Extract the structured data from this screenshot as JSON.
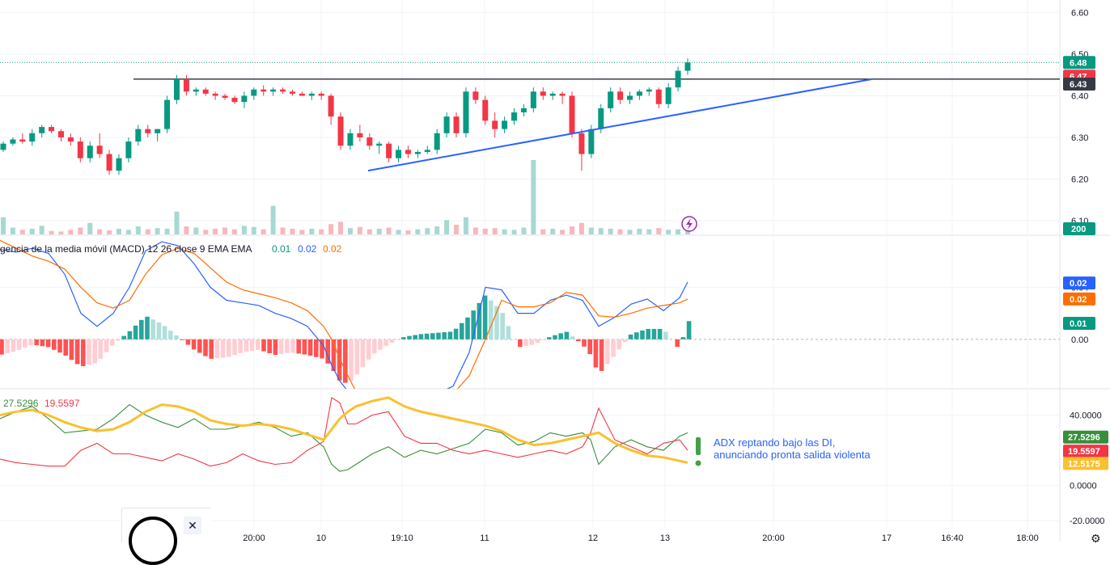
{
  "chart_data": [
    {
      "type": "candlestick",
      "panel": "price",
      "y_ticks": [
        "6.60",
        "6.50",
        "6.40",
        "6.30",
        "6.20",
        "6.10"
      ],
      "y_tick_values": [
        6.6,
        6.5,
        6.4,
        6.3,
        6.2,
        6.1
      ],
      "ylim": [
        6.065,
        6.63
      ],
      "price_tags": [
        {
          "label": "6.48",
          "value": 6.48,
          "color": "#089981"
        },
        {
          "label": "6.47",
          "value": 6.447,
          "color": "#f23645"
        },
        {
          "label": "6.43",
          "value": 6.428,
          "color": "#363a45"
        }
      ],
      "volume_tag": {
        "label": "200",
        "color": "#089981"
      },
      "last_price_line": 6.48,
      "horizontal_line": 6.44,
      "trendline": {
        "from": [
          455,
          6.22
        ],
        "to": [
          1078,
          6.44
        ],
        "color": "#2962ff"
      },
      "candles": [
        [
          6.27,
          6.29,
          6.265,
          6.285
        ],
        [
          6.285,
          6.3,
          6.28,
          6.295
        ],
        [
          6.295,
          6.31,
          6.285,
          6.29
        ],
        [
          6.29,
          6.32,
          6.28,
          6.31
        ],
        [
          6.31,
          6.33,
          6.3,
          6.325
        ],
        [
          6.325,
          6.33,
          6.31,
          6.315
        ],
        [
          6.315,
          6.32,
          6.29,
          6.3
        ],
        [
          6.3,
          6.31,
          6.28,
          6.29
        ],
        [
          6.29,
          6.3,
          6.24,
          6.25
        ],
        [
          6.25,
          6.29,
          6.24,
          6.28
        ],
        [
          6.28,
          6.31,
          6.25,
          6.26
        ],
        [
          6.26,
          6.27,
          6.21,
          6.22
        ],
        [
          6.22,
          6.26,
          6.21,
          6.25
        ],
        [
          6.25,
          6.3,
          6.24,
          6.29
        ],
        [
          6.29,
          6.33,
          6.28,
          6.32
        ],
        [
          6.32,
          6.33,
          6.3,
          6.31
        ],
        [
          6.31,
          6.32,
          6.29,
          6.32
        ],
        [
          6.32,
          6.4,
          6.31,
          6.39
        ],
        [
          6.39,
          6.45,
          6.38,
          6.44
        ],
        [
          6.44,
          6.45,
          6.4,
          6.41
        ],
        [
          6.41,
          6.42,
          6.4,
          6.415
        ],
        [
          6.415,
          6.42,
          6.4,
          6.405
        ],
        [
          6.405,
          6.41,
          6.39,
          6.4
        ],
        [
          6.4,
          6.405,
          6.39,
          6.395
        ],
        [
          6.395,
          6.4,
          6.38,
          6.385
        ],
        [
          6.385,
          6.41,
          6.37,
          6.4
        ],
        [
          6.4,
          6.42,
          6.39,
          6.415
        ],
        [
          6.415,
          6.425,
          6.4,
          6.41
        ],
        [
          6.41,
          6.42,
          6.4,
          6.415
        ],
        [
          6.415,
          6.42,
          6.405,
          6.41
        ],
        [
          6.41,
          6.415,
          6.4,
          6.405
        ],
        [
          6.405,
          6.41,
          6.4,
          6.4
        ],
        [
          6.4,
          6.41,
          6.39,
          6.405
        ],
        [
          6.405,
          6.41,
          6.39,
          6.4
        ],
        [
          6.4,
          6.405,
          6.33,
          6.35
        ],
        [
          6.35,
          6.36,
          6.27,
          6.28
        ],
        [
          6.28,
          6.32,
          6.27,
          6.31
        ],
        [
          6.31,
          6.33,
          6.29,
          6.3
        ],
        [
          6.3,
          6.31,
          6.27,
          6.28
        ],
        [
          6.28,
          6.29,
          6.26,
          6.285
        ],
        [
          6.285,
          6.29,
          6.24,
          6.25
        ],
        [
          6.25,
          6.28,
          6.24,
          6.27
        ],
        [
          6.27,
          6.28,
          6.25,
          6.26
        ],
        [
          6.26,
          6.27,
          6.25,
          6.265
        ],
        [
          6.265,
          6.28,
          6.26,
          6.27
        ],
        [
          6.27,
          6.32,
          6.26,
          6.31
        ],
        [
          6.31,
          6.36,
          6.3,
          6.35
        ],
        [
          6.35,
          6.36,
          6.3,
          6.31
        ],
        [
          6.31,
          6.42,
          6.3,
          6.41
        ],
        [
          6.41,
          6.42,
          6.38,
          6.39
        ],
        [
          6.39,
          6.4,
          6.33,
          6.34
        ],
        [
          6.34,
          6.36,
          6.3,
          6.32
        ],
        [
          6.32,
          6.35,
          6.31,
          6.34
        ],
        [
          6.34,
          6.37,
          6.33,
          6.36
        ],
        [
          6.36,
          6.38,
          6.35,
          6.37
        ],
        [
          6.37,
          6.42,
          6.36,
          6.41
        ],
        [
          6.41,
          6.42,
          6.39,
          6.4
        ],
        [
          6.4,
          6.41,
          6.39,
          6.405
        ],
        [
          6.405,
          6.41,
          6.38,
          6.4
        ],
        [
          6.4,
          6.41,
          6.3,
          6.31
        ],
        [
          6.31,
          6.32,
          6.22,
          6.26
        ],
        [
          6.26,
          6.33,
          6.25,
          6.32
        ],
        [
          6.32,
          6.38,
          6.31,
          6.37
        ],
        [
          6.37,
          6.42,
          6.36,
          6.41
        ],
        [
          6.41,
          6.42,
          6.38,
          6.39
        ],
        [
          6.39,
          6.41,
          6.38,
          6.4
        ],
        [
          6.4,
          6.415,
          6.39,
          6.41
        ],
        [
          6.41,
          6.42,
          6.4,
          6.415
        ],
        [
          6.415,
          6.42,
          6.37,
          6.38
        ],
        [
          6.38,
          6.43,
          6.37,
          6.42
        ],
        [
          6.42,
          6.47,
          6.41,
          6.46
        ],
        [
          6.46,
          6.49,
          6.45,
          6.48
        ]
      ],
      "volume": [
        30,
        12,
        8,
        10,
        15,
        6,
        5,
        8,
        12,
        20,
        9,
        7,
        10,
        8,
        14,
        9,
        11,
        10,
        40,
        14,
        12,
        8,
        10,
        12,
        9,
        15,
        13,
        9,
        50,
        12,
        10,
        8,
        10,
        9,
        18,
        22,
        11,
        13,
        9,
        10,
        12,
        8,
        7,
        9,
        11,
        14,
        25,
        17,
        30,
        12,
        10,
        11,
        9,
        8,
        12,
        130,
        9,
        10,
        8,
        14,
        20,
        12,
        11,
        10,
        9,
        8,
        10,
        9,
        11,
        8,
        9,
        10
      ]
    },
    {
      "type": "line",
      "panel": "macd",
      "legend": {
        "label": "gencia de la media móvil (MACD)  12 26 close 9 EMA EMA",
        "values": [
          "0.01",
          "0.02",
          "0.02"
        ]
      },
      "y_ticks": [
        "0.04",
        "0.00"
      ],
      "y_tick_values": [
        0.04,
        0.0
      ],
      "ylim": [
        -0.038,
        0.08
      ],
      "tags": [
        {
          "label": "0.02",
          "value": 0.0433,
          "color": "#2962ff"
        },
        {
          "label": "0.02",
          "value": 0.031,
          "color": "#ff6d00"
        },
        {
          "label": "0.01",
          "value": 0.0123,
          "color": "#089981"
        }
      ],
      "x": [
        0,
        20,
        40,
        60,
        80,
        100,
        120,
        140,
        160,
        180,
        200,
        220,
        240,
        260,
        280,
        300,
        320,
        340,
        360,
        380,
        400,
        410,
        420,
        430,
        440,
        460,
        480,
        500,
        520,
        540,
        560,
        580,
        600,
        620,
        640,
        660,
        680,
        700,
        720,
        730,
        740,
        760,
        780,
        800,
        820,
        840,
        850
      ],
      "macd_line": [
        0.069,
        0.067,
        0.07,
        0.066,
        0.05,
        0.02,
        0.01,
        0.02,
        0.04,
        0.068,
        0.075,
        0.072,
        0.058,
        0.04,
        0.03,
        0.028,
        0.026,
        0.02,
        0.016,
        0.01,
        -0.005,
        -0.02,
        -0.032,
        -0.04,
        -0.045,
        -0.05,
        -0.052,
        -0.05,
        -0.046,
        -0.042,
        -0.036,
        -0.01,
        0.04,
        0.038,
        0.02,
        0.02,
        0.03,
        0.034,
        0.03,
        0.02,
        0.01,
        0.017,
        0.027,
        0.031,
        0.022,
        0.032,
        0.044
      ],
      "signal_line": [
        0.076,
        0.07,
        0.064,
        0.06,
        0.054,
        0.04,
        0.028,
        0.024,
        0.03,
        0.05,
        0.065,
        0.07,
        0.066,
        0.055,
        0.044,
        0.038,
        0.035,
        0.032,
        0.028,
        0.022,
        0.01,
        0.0,
        -0.015,
        -0.028,
        -0.04,
        -0.048,
        -0.05,
        -0.051,
        -0.05,
        -0.047,
        -0.042,
        -0.028,
        0.0,
        0.03,
        0.025,
        0.025,
        0.028,
        0.036,
        0.034,
        0.026,
        0.018,
        0.017,
        0.02,
        0.024,
        0.026,
        0.028,
        0.031
      ],
      "histogram": [
        -0.012,
        -0.009,
        -0.004,
        -0.006,
        -0.012,
        -0.021,
        -0.018,
        -0.004,
        0.006,
        0.018,
        0.012,
        0.002,
        -0.008,
        -0.015,
        -0.014,
        -0.01,
        -0.008,
        -0.012,
        -0.01,
        -0.012,
        -0.015,
        -0.022,
        -0.032,
        -0.034,
        -0.028,
        -0.012,
        -0.004,
        0.002,
        0.004,
        0.005,
        0.006,
        0.018,
        0.034,
        0.022,
        -0.006,
        -0.004,
        0.002,
        0.006,
        -0.004,
        -0.012,
        -0.027,
        -0.012,
        0.004,
        0.008,
        0.008,
        -0.008,
        0.014
      ]
    },
    {
      "type": "line",
      "panel": "adx",
      "legend": {
        "values": [
          "27.5296",
          "19.5597"
        ]
      },
      "y_ticks": [
        "40.0000",
        "0.0000",
        "-20.0000"
      ],
      "y_tick_values": [
        40,
        0,
        -20
      ],
      "ylim": [
        -25,
        55
      ],
      "tags": [
        {
          "label": "27.5296",
          "value": 27.53,
          "color": "#388e3c"
        },
        {
          "label": "19.5597",
          "value": 19.56,
          "color": "#f23645"
        },
        {
          "label": "12.5175",
          "value": 12.52,
          "color": "#fbc02d"
        }
      ],
      "x": [
        0,
        20,
        40,
        60,
        80,
        100,
        120,
        140,
        160,
        180,
        200,
        220,
        240,
        260,
        280,
        300,
        320,
        340,
        360,
        380,
        400,
        410,
        420,
        430,
        440,
        460,
        480,
        500,
        520,
        540,
        560,
        580,
        600,
        620,
        640,
        660,
        680,
        700,
        720,
        730,
        740,
        760,
        780,
        800,
        820,
        840,
        850
      ],
      "di_plus": [
        38,
        42,
        45,
        38,
        30,
        31,
        32,
        38,
        46,
        40,
        36,
        33,
        38,
        32,
        32,
        34,
        36,
        33,
        28,
        30,
        22,
        12,
        8,
        9,
        12,
        18,
        22,
        16,
        20,
        18,
        21,
        24,
        32,
        30,
        23,
        25,
        30,
        28,
        30,
        26,
        12,
        22,
        26,
        22,
        20,
        28,
        30
      ],
      "di_minus": [
        15,
        13,
        12,
        11,
        11,
        20,
        24,
        18,
        18,
        16,
        14,
        18,
        15,
        11,
        13,
        18,
        14,
        12,
        13,
        20,
        25,
        50,
        47,
        35,
        35,
        40,
        42,
        28,
        24,
        24,
        20,
        18,
        20,
        18,
        16,
        18,
        20,
        18,
        22,
        30,
        44,
        26,
        22,
        18,
        24,
        26,
        20
      ],
      "adx": [
        40,
        42,
        43,
        40,
        36,
        33,
        31,
        32,
        36,
        42,
        46,
        45,
        42,
        37,
        35,
        34,
        35,
        34,
        32,
        29,
        26,
        32,
        38,
        42,
        45,
        48,
        50,
        45,
        42,
        40,
        38,
        36,
        34,
        31,
        26,
        23,
        24,
        26,
        28,
        29,
        30,
        24,
        20,
        17,
        16,
        14,
        13
      ],
      "annotation": "ADX reptando bajo las DI,\nanunciando pronta salida violenta"
    }
  ],
  "time_axis": {
    "labels": [
      {
        "text": "20:00",
        "x": 314
      },
      {
        "text": "10",
        "x": 397
      },
      {
        "text": "19:10",
        "x": 497
      },
      {
        "text": "11",
        "x": 599
      },
      {
        "text": "12",
        "x": 733
      },
      {
        "text": "13",
        "x": 822
      },
      {
        "text": "20:00",
        "x": 956
      },
      {
        "text": "17",
        "x": 1096
      },
      {
        "text": "16:40",
        "x": 1177
      },
      {
        "text": "18:00",
        "x": 1270
      }
    ]
  },
  "annotation_lines": [
    "ADX reptando bajo las DI,",
    "anunciando pronta salida violenta"
  ],
  "colors": {
    "up": "#089981",
    "down": "#f23645",
    "macd": "#2962ff",
    "signal": "#ff6d00",
    "hist_up_strong": "#26a69a",
    "hist_up_weak": "#b2dfdb",
    "hist_down_strong": "#ff5252",
    "hist_down_weak": "#ffcdd2",
    "di_plus": "#388e3c",
    "di_minus": "#f23645",
    "adx": "#fbc02d"
  },
  "ui": {
    "popup_close": "✕",
    "gear_icon": "⚙",
    "event_icon": "lightning-icon"
  }
}
